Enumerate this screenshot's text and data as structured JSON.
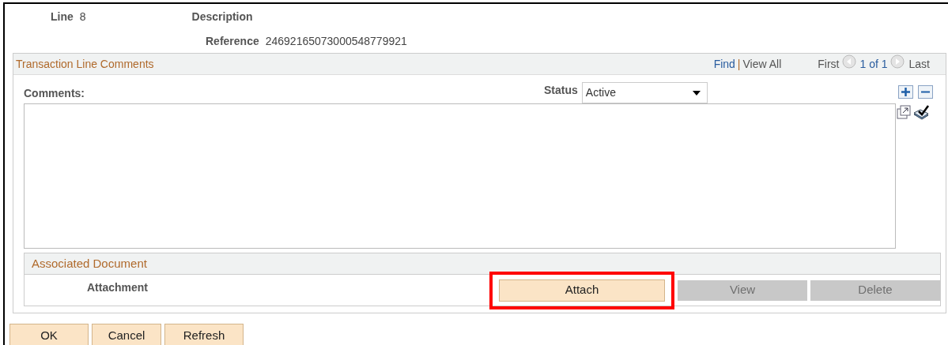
{
  "header": {
    "line_label": "Line",
    "line_value": "8",
    "description_label": "Description",
    "reference_label": "Reference",
    "reference_value": "24692165073000548779921"
  },
  "comments_panel": {
    "title": "Transaction Line Comments",
    "nav": {
      "find": "Find",
      "separator": "|",
      "view_all": "View All",
      "first": "First",
      "position": "1 of 1",
      "last": "Last"
    },
    "comments_label": "Comments:",
    "status_label": "Status",
    "status_value": "Active",
    "associated_document": {
      "title": "Associated Document",
      "attachment_label": "Attachment",
      "buttons": [
        {
          "label": "Attach",
          "disabled": false,
          "highlighted": true
        },
        {
          "label": "View",
          "disabled": true,
          "highlighted": false
        },
        {
          "label": "Delete",
          "disabled": true,
          "highlighted": false
        }
      ]
    }
  },
  "buttons": [
    "OK",
    "Cancel",
    "Refresh"
  ]
}
